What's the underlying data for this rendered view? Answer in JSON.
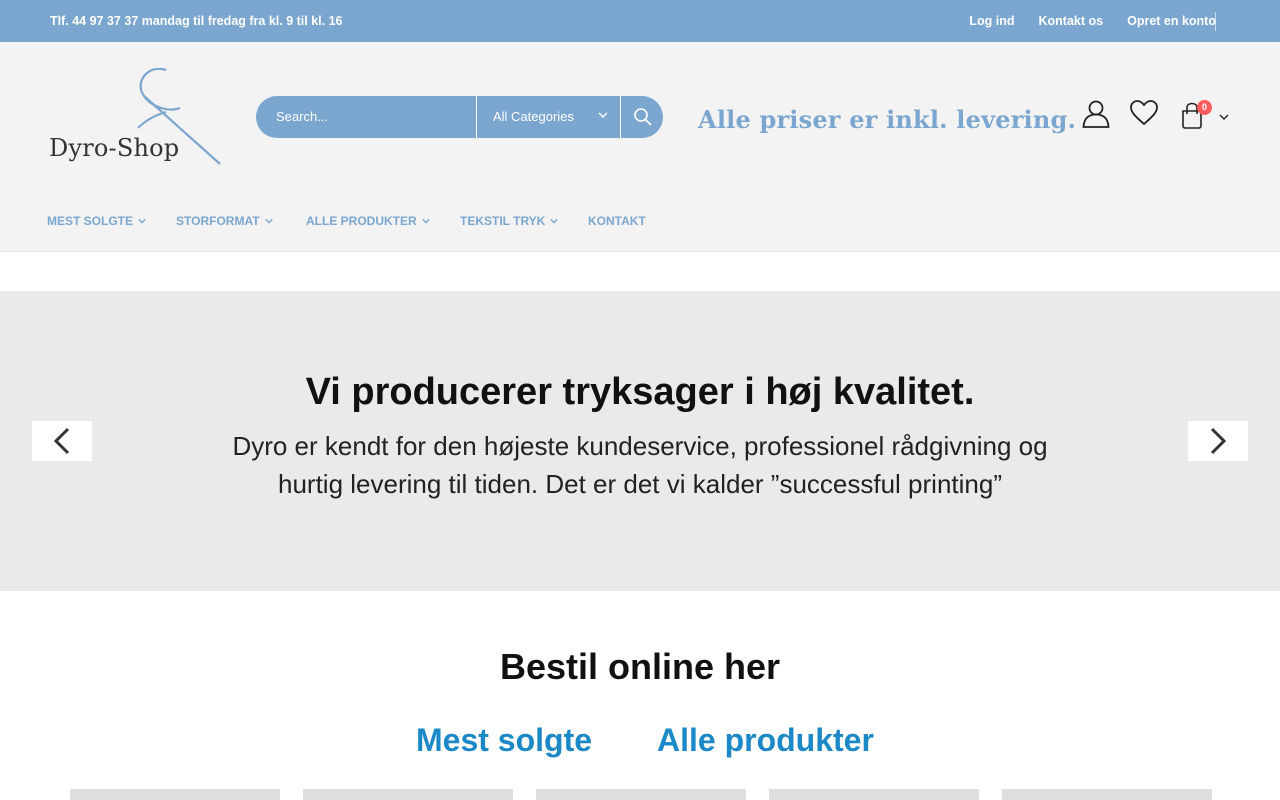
{
  "topbar": {
    "phone": "Tlf. 44 97 37 37 mandag til fredag fra kl. 9 til kl. 16",
    "links": [
      "Log ind",
      "Kontakt os",
      "Opret en konto"
    ]
  },
  "logo": {
    "text": "Dyro-Shop"
  },
  "search": {
    "placeholder": "Search...",
    "category": "All Categories"
  },
  "tagline": "Alle priser er inkl. levering.",
  "cart": {
    "count": "0"
  },
  "nav": {
    "items": [
      "MEST SOLGTE",
      "STORFORMAT",
      "ALLE PRODUKTER",
      "TEKSTIL TRYK",
      "KONTAKT"
    ]
  },
  "hero": {
    "title": "Vi producerer tryksager i høj kvalitet.",
    "subtitle": "Dyro er kendt for den højeste kundeservice, professionel rådgivning og hurtig levering til tiden. Det er det vi kalder ”successful printing”"
  },
  "section": {
    "title": "Bestil online her",
    "tabs": [
      "Mest solgte",
      "Alle produkter"
    ]
  },
  "colors": {
    "brand": "#7aa6cf",
    "link": "#1b88c7",
    "badge": "#ff5b5b"
  }
}
